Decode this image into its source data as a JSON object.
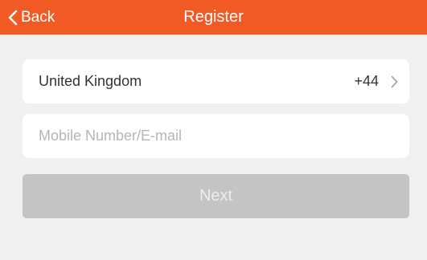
{
  "header": {
    "back_label": "Back",
    "back_icon": "chevron-left-icon",
    "title": "Register",
    "bar_color": "#f15a24"
  },
  "form": {
    "country": {
      "name": "United Kingdom",
      "code": "+44",
      "icon": "chevron-right-icon"
    },
    "account_input": {
      "placeholder": "Mobile Number/E-mail",
      "value": ""
    },
    "next_label": "Next"
  }
}
